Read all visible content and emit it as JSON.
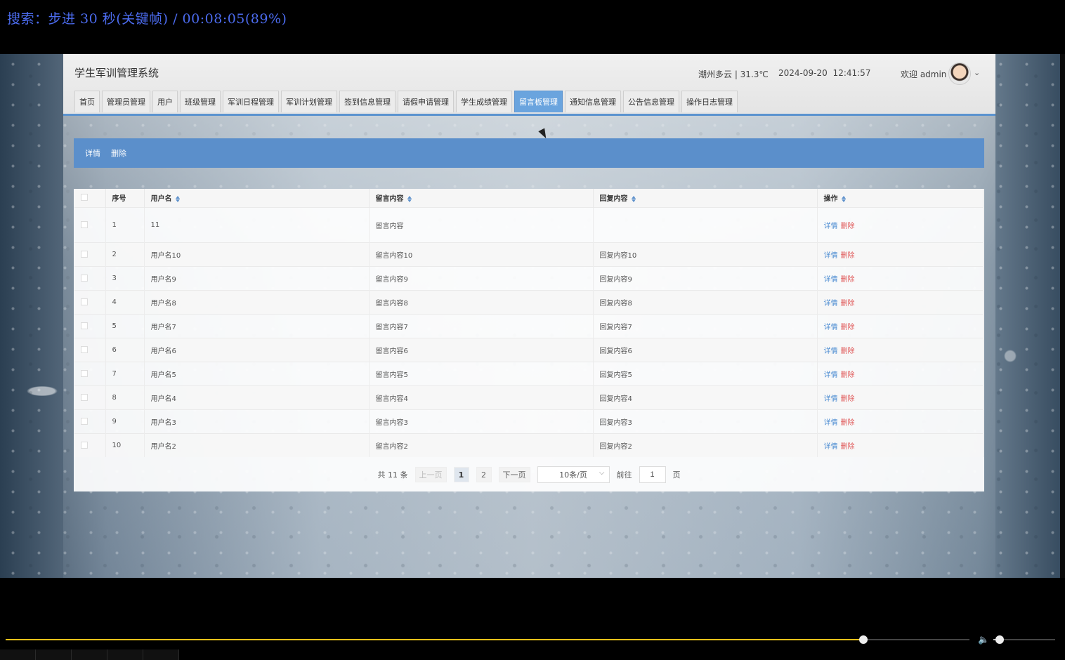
{
  "osd": {
    "text": "搜索：步进 30 秒(关键帧) / 00:08:05(89%)"
  },
  "app": {
    "title": "学生军训管理系统",
    "weather": "潮州多云 | 31.3℃",
    "datetime": "2024-09-20  12:41:57",
    "welcome": "欢迎 admin",
    "nav": [
      "首页",
      "管理员管理",
      "用户",
      "班级管理",
      "军训日程管理",
      "军训计划管理",
      "签到信息管理",
      "请假申请管理",
      "学生成绩管理",
      "留言板管理",
      "通知信息管理",
      "公告信息管理",
      "操作日志管理"
    ],
    "active_nav": "留言板管理"
  },
  "toolbar": {
    "detail": "详情",
    "delete": "删除"
  },
  "table": {
    "headers": {
      "index": "序号",
      "username": "用户名",
      "content": "留言内容",
      "reply": "回复内容",
      "actions": "操作"
    },
    "action_detail": "详情",
    "action_delete": "删除",
    "rows": [
      {
        "index": "1",
        "username": "11",
        "content": "留言内容",
        "reply": ""
      },
      {
        "index": "2",
        "username": "用户名10",
        "content": "留言内容10",
        "reply": "回复内容10"
      },
      {
        "index": "3",
        "username": "用户名9",
        "content": "留言内容9",
        "reply": "回复内容9"
      },
      {
        "index": "4",
        "username": "用户名8",
        "content": "留言内容8",
        "reply": "回复内容8"
      },
      {
        "index": "5",
        "username": "用户名7",
        "content": "留言内容7",
        "reply": "回复内容7"
      },
      {
        "index": "6",
        "username": "用户名6",
        "content": "留言内容6",
        "reply": "回复内容6"
      },
      {
        "index": "7",
        "username": "用户名5",
        "content": "留言内容5",
        "reply": "回复内容5"
      },
      {
        "index": "8",
        "username": "用户名4",
        "content": "留言内容4",
        "reply": "回复内容4"
      },
      {
        "index": "9",
        "username": "用户名3",
        "content": "留言内容3",
        "reply": "回复内容3"
      },
      {
        "index": "10",
        "username": "用户名2",
        "content": "留言内容2",
        "reply": "回复内容2"
      }
    ]
  },
  "pager": {
    "total": "共 11 条",
    "prev": "上一页",
    "pages": [
      "1",
      "2"
    ],
    "current": "1",
    "next": "下一页",
    "page_size": "10条/页",
    "goto_label": "前往",
    "goto_value": "1",
    "page_suffix": "页"
  },
  "player": {
    "progress": 0.89,
    "volume": 0.1
  },
  "colors": {
    "accent": "#5b8fcb",
    "active_tab": "#6aa4de",
    "delete": "#e05a5a",
    "detail": "#4a8bd1",
    "osd": "#4c6cf0",
    "seek": "#e8c21a"
  }
}
